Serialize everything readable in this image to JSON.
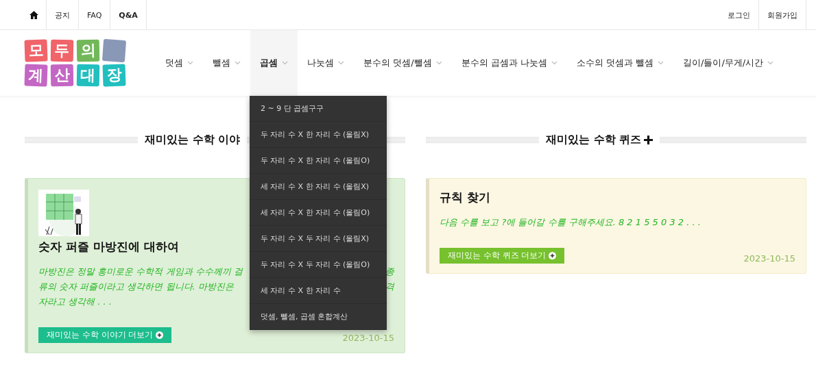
{
  "top_bar": {
    "left_links": [
      "공지",
      "FAQ",
      "Q&A"
    ],
    "right_links": [
      "로그인",
      "회원가입"
    ]
  },
  "logo": {
    "rows": [
      [
        {
          "char": "모",
          "color": "#f0646a"
        },
        {
          "char": "두",
          "color": "#f0646a"
        },
        {
          "char": "의",
          "color": "#72b85a"
        },
        {
          "color": "#8a98b8"
        }
      ],
      [
        {
          "char": "계",
          "color": "#c467c4"
        },
        {
          "char": "산",
          "color": "#c467c4"
        },
        {
          "char": "대",
          "color": "#22bfbf"
        },
        {
          "char": "장",
          "color": "#22bfbf"
        }
      ]
    ]
  },
  "nav": [
    {
      "label": "덧셈",
      "selected": false
    },
    {
      "label": "뺄셈",
      "selected": false
    },
    {
      "label": "곱셈",
      "selected": true
    },
    {
      "label": "나눗셈",
      "selected": false
    },
    {
      "label": "분수의 덧셈/뺄셈",
      "selected": false
    },
    {
      "label": "분수의 곱셈과 나눗셈",
      "selected": false
    },
    {
      "label": "소수의 덧셈과 뺄셈",
      "selected": false
    },
    {
      "label": "길이/들이/무게/시간",
      "selected": false
    }
  ],
  "dropdown": [
    "2 ~ 9 단 곱셈구구",
    "두 자리 수 X 한 자리 수 (올림X)",
    "두 자리 수 X 한 자리 수 (올림O)",
    "세 자리 수 X 한 자리 수 (올림X)",
    "세 자리 수 X 한 자리 수 (올림O)",
    "두 자리 수 X 두 자리 수 (올림X)",
    "두 자리 수 X 두 자리 수 (올림O)",
    "세 자리 수 X 한 자리 수",
    "덧셈, 뺄셈, 곱셈 혼합계산"
  ],
  "sections": [
    {
      "heading": "재미있는 수학 이야",
      "heading_plus": false,
      "kind": "story",
      "card": {
        "has_picture": true,
        "title": "숫자 퍼즐 마방진에 대하여",
        "excerpt_lines": [
          {
            "left": "마방진은 정말 흥미로운 수학적 게임과 수수께끼 걸",
            "right": "종"
          },
          {
            "left": "류의 숫자 퍼즐이라고 생각하면 됩니다. 마방진은",
            "right": "격"
          },
          {
            "left": "자라고 생각해 . . ."
          }
        ],
        "button": "재미있는 수학 이야기 더보기",
        "date": "2023-10-15"
      }
    },
    {
      "heading": "재미있는 수학 퀴즈",
      "heading_plus": true,
      "kind": "quiz",
      "card": {
        "has_picture": false,
        "title": "규칙 찾기",
        "excerpt_lines": [
          {
            "left": "다음 수를 보고 ?에 들어갈 수를 구해주세요. 8 2 1 5 5 0 3 2 . . ."
          }
        ],
        "button": "재미있는 수학 퀴즈 더보기",
        "date": "2023-10-15"
      }
    }
  ]
}
